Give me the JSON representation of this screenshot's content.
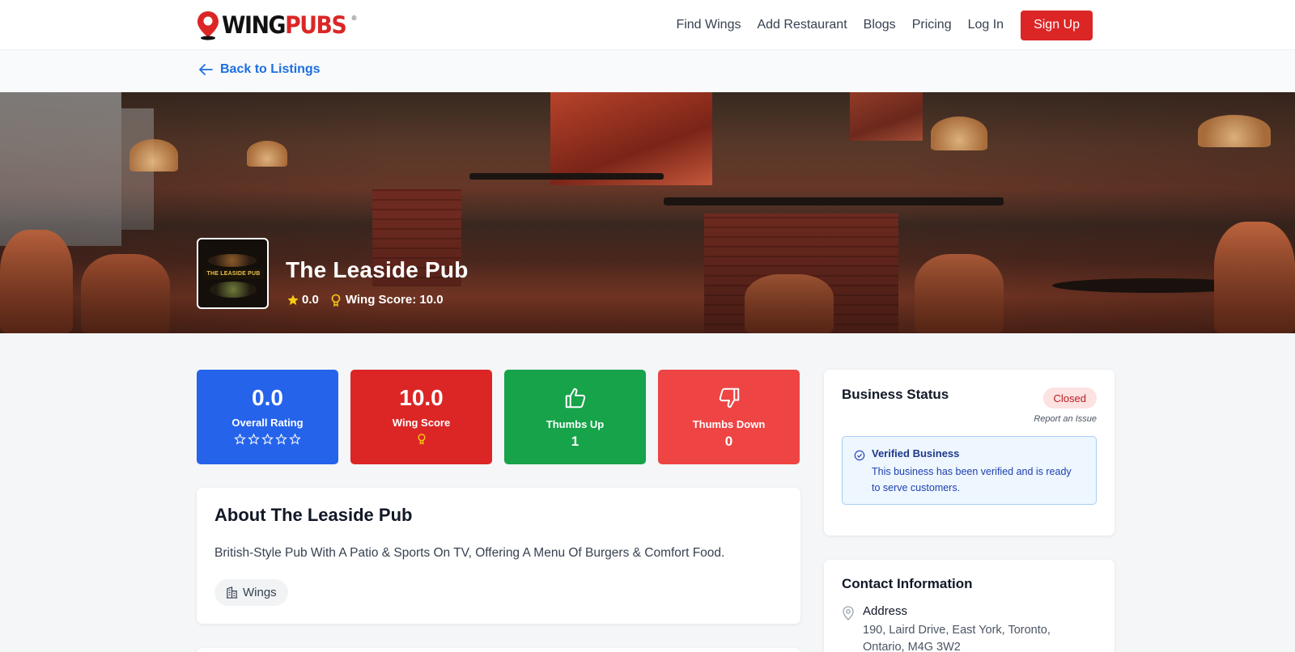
{
  "brand": {
    "logo_wing": "WING",
    "logo_pubs": "PUBS",
    "registered": "®"
  },
  "nav": {
    "items": [
      "Find Wings",
      "Add Restaurant",
      "Blogs",
      "Pricing",
      "Log In"
    ],
    "signup": "Sign Up"
  },
  "back": {
    "label": "Back to Listings"
  },
  "restaurant": {
    "name": "The Leaside Pub",
    "logo_text": "THE LEASIDE PUB",
    "rating": "0.0",
    "wing_score_text": "Wing Score: 10.0"
  },
  "stats": {
    "overall": {
      "value": "0.0",
      "label": "Overall Rating",
      "stars": 0,
      "max_stars": 5,
      "color": "#2563eb"
    },
    "wing": {
      "value": "10.0",
      "label": "Wing Score",
      "color": "#dc2626"
    },
    "up": {
      "label": "Thumbs Up",
      "count": "1",
      "color": "#16a34a"
    },
    "down": {
      "label": "Thumbs Down",
      "count": "0",
      "color": "#ef4444"
    }
  },
  "about": {
    "title": "About The Leaside Pub",
    "description": "British-Style Pub With A Patio & Sports On TV, Offering A Menu Of Burgers & Comfort Food.",
    "tag": "Wings"
  },
  "business_status": {
    "title": "Business Status",
    "status": "Closed",
    "report": "Report an Issue",
    "verified_title": "Verified Business",
    "verified_text": "This business has been verified and is ready to serve customers."
  },
  "contact": {
    "title": "Contact Information",
    "address_label": "Address",
    "address": "190, Laird Drive, East York, Toronto, Ontario, M4G 3W2"
  },
  "colors": {
    "accent_red": "#dc2626",
    "link_blue": "#1d6fe0",
    "star": "#facc15"
  }
}
